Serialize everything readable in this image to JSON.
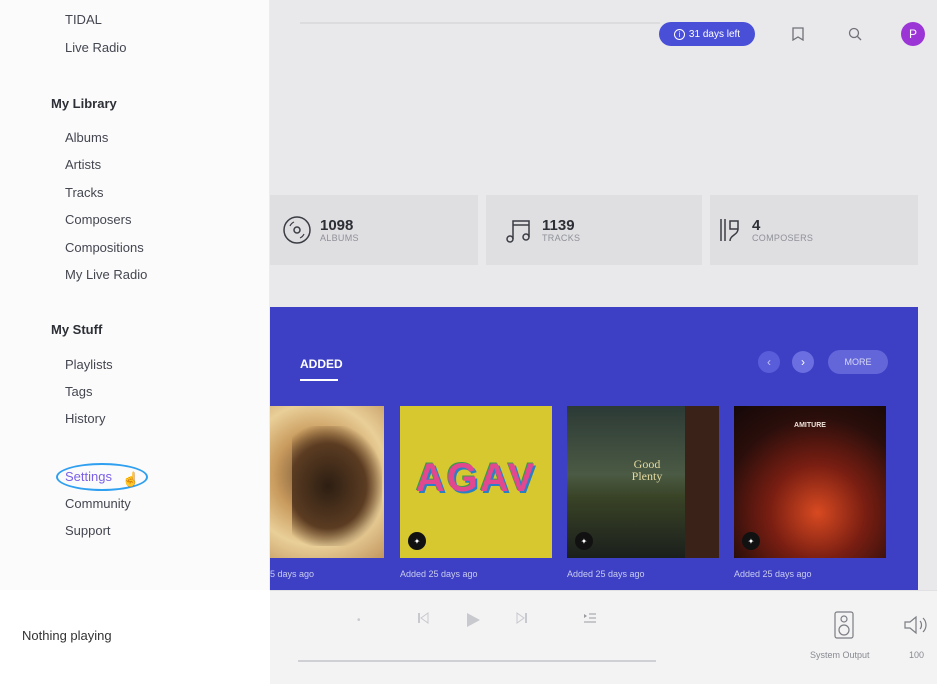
{
  "header": {
    "trial_label": "31 days left",
    "avatar_letter": "P"
  },
  "stats": [
    {
      "number": "1098",
      "label": "ALBUMS"
    },
    {
      "number": "1139",
      "label": "TRACKS"
    },
    {
      "number": "4",
      "label": "COMPOSERS"
    }
  ],
  "recent": {
    "tab_label": "ADDED",
    "more_label": "MORE",
    "albums": [
      {
        "art_text": "",
        "caption": "5 days ago"
      },
      {
        "art_text": "AGAV",
        "caption": "Added 25 days ago"
      },
      {
        "art_text": "Good Plenty",
        "caption": "Added 25 days ago"
      },
      {
        "art_text": "AMITURE",
        "caption": "Added 25 days ago"
      }
    ]
  },
  "sidebar": {
    "top_items": [
      "TIDAL",
      "Live Radio"
    ],
    "my_library": {
      "heading": "My Library",
      "items": [
        "Albums",
        "Artists",
        "Tracks",
        "Composers",
        "Compositions",
        "My Live Radio"
      ]
    },
    "my_stuff": {
      "heading": "My Stuff",
      "items": [
        "Playlists",
        "Tags",
        "History"
      ]
    },
    "bottom_items": [
      "Settings",
      "Community",
      "Support"
    ]
  },
  "player": {
    "now_playing": "Nothing playing",
    "output_label": "System Output",
    "volume": "100"
  },
  "colors": {
    "accent": "#3d40c5",
    "trial_pill": "#4a4fd8",
    "avatar": "#9b35d6",
    "active_sidebar": "#7b5fe6",
    "highlight_ring": "#2f9ff0"
  }
}
